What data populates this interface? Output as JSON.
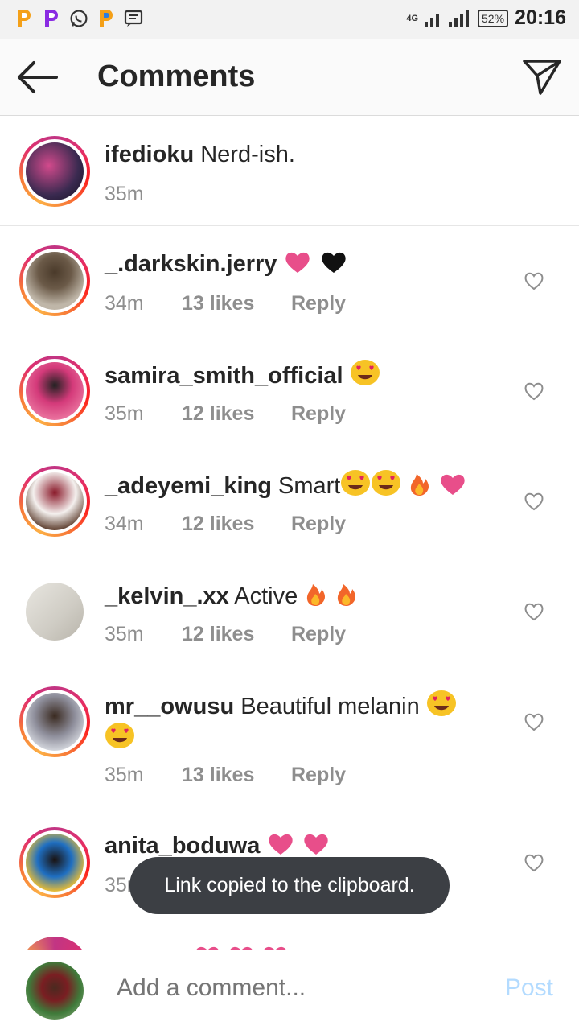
{
  "status_bar": {
    "app_icons": [
      "P",
      "P",
      "whatsapp",
      "P",
      "message"
    ],
    "network": "4G",
    "battery": "52%",
    "time": "20:16"
  },
  "header": {
    "title": "Comments"
  },
  "caption": {
    "username": "ifedioku",
    "text": "Nerd-ish.",
    "time": "35m"
  },
  "comments": [
    {
      "username": "_.darkskin.jerry",
      "text": "",
      "time": "34m",
      "likes": "13 likes",
      "reply": "Reply"
    },
    {
      "username": "samira_smith_official",
      "text": "",
      "time": "35m",
      "likes": "12 likes",
      "reply": "Reply"
    },
    {
      "username": "_adeyemi_king",
      "text": "Smart",
      "time": "34m",
      "likes": "12 likes",
      "reply": "Reply"
    },
    {
      "username": "_kelvin_.xx",
      "text": "Active",
      "time": "35m",
      "likes": "12 likes",
      "reply": "Reply"
    },
    {
      "username": "mr__owusu",
      "text": "Beautiful melanin",
      "time": "35m",
      "likes": "13 likes",
      "reply": "Reply"
    },
    {
      "username": "anita_boduwa",
      "text": "",
      "time": "35m",
      "likes": "",
      "reply": ""
    }
  ],
  "toast": "Link copied to the clipboard.",
  "composer": {
    "placeholder": "Add a comment...",
    "post_label": "Post"
  },
  "colors": {
    "heart_pink": "#e84e8a",
    "post_disabled": "#b3dbff",
    "toast_bg": "#3c3f44"
  }
}
